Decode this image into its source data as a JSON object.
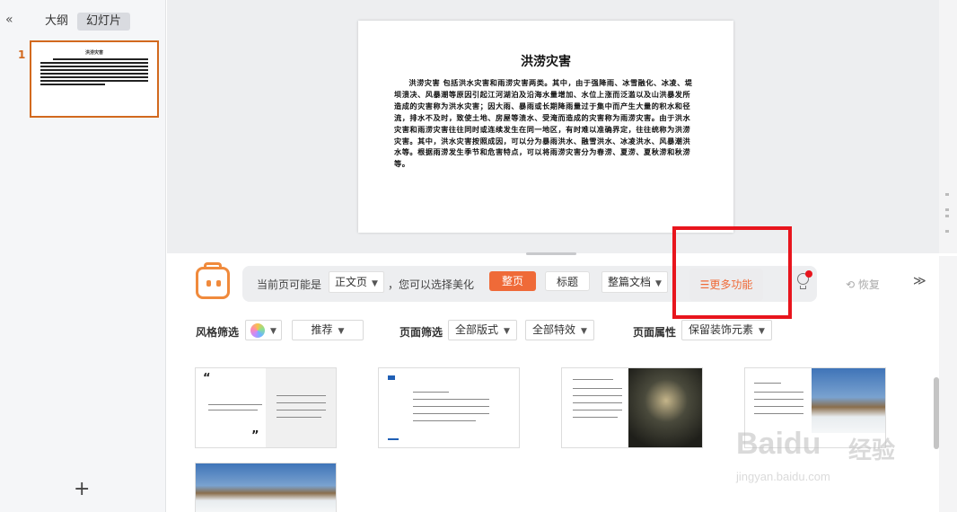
{
  "sidebar": {
    "collapse_icon": "«",
    "tabs": [
      {
        "label": "大纲"
      },
      {
        "label": "幻灯片"
      }
    ],
    "slide_number": "1",
    "thumb_title": "洪涝灾害",
    "add_icon": "+"
  },
  "slide": {
    "title": "洪涝灾害",
    "body": "洪涝灾害 包括洪水灾害和雨涝灾害两类。其中，由于强降雨、冰雪融化、冰凌、堤坝溃决、风暴潮等原因引起江河湖泊及沿海水量增加、水位上涨而泛滥以及山洪暴发所造成的灾害称为洪水灾害；因大雨、暴雨或长期降雨量过于集中而产生大量的积水和径流，排水不及时，致使土地、房屋等渍水、受淹而造成的灾害称为雨涝灾害。由于洪水灾害和雨涝灾害往往同时或连续发生在同一地区，有时难以准确界定，往往统称为洪涝灾害。其中，洪水灾害按照成因，可以分为暴雨洪水、融雪洪水、冰凌洪水、风暴潮洪水等。根据雨涝发生季节和危害特点，可以将雨涝灾害分为春涝、夏涝、夏秋涝和秋涝等。"
  },
  "beautify": {
    "current_label": "当前页可能是",
    "page_type": "正文页",
    "choose_label": "，您可以选择美化",
    "btn_full": "整页",
    "btn_title": "标题",
    "whole_doc": "整篇文档",
    "more": "☰更多功能",
    "restore": "⟲ 恢复",
    "expand_icon": "≫"
  },
  "filters": {
    "style_label": "风格筛选",
    "recommend": "推荐",
    "page_label": "页面筛选",
    "all_layouts": "全部版式",
    "all_effects": "全部特效",
    "attr_label": "页面属性",
    "keep_decor": "保留装饰元素"
  },
  "watermark": {
    "brand": "Baidu",
    "brand_cn": "经验",
    "url": "jingyan.baidu.com"
  },
  "colors": {
    "accent": "#ef6a38",
    "highlight": "#e8151d",
    "thumb_border": "#d2691e"
  }
}
